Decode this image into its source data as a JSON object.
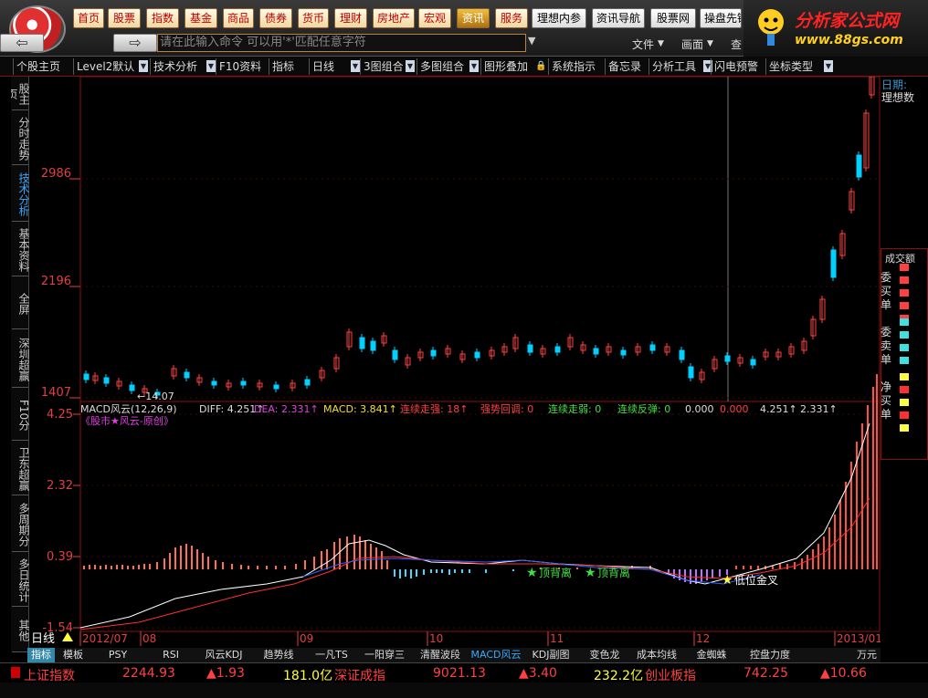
{
  "menu": {
    "items": [
      {
        "label": "首页",
        "active": false
      },
      {
        "label": "股票",
        "active": false
      },
      {
        "label": "指数",
        "active": false
      },
      {
        "label": "基金",
        "active": false
      },
      {
        "label": "商品",
        "active": false
      },
      {
        "label": "债券",
        "active": false
      },
      {
        "label": "货币",
        "active": false
      },
      {
        "label": "理财",
        "active": false
      },
      {
        "label": "房地产",
        "active": false
      },
      {
        "label": "宏观",
        "active": false
      },
      {
        "label": "资讯",
        "active": true
      },
      {
        "label": "服务",
        "active": false
      }
    ],
    "extra": [
      "理想内参",
      "资讯导航",
      "股票网",
      "操盘先锋"
    ],
    "command_placeholder": "请在此输入命令   可以用'*'匹配任意字符",
    "right_menu": [
      "文件",
      "画面",
      "查"
    ]
  },
  "brand": {
    "title": "分析家公式网",
    "url": "www.88gs.com"
  },
  "toolbar": {
    "items": [
      "个股主页",
      "Level2默认",
      "技术分析",
      "F10资料",
      "指标",
      "日线",
      "3图组合",
      "多图组合",
      "图形叠加",
      "系统指示",
      "备忘录",
      "分析工具",
      "闪电预警",
      "坐标类型"
    ]
  },
  "left_tabs": [
    {
      "label": "股主页",
      "active": false
    },
    {
      "label": "分时走势",
      "active": false
    },
    {
      "label": "技术分析",
      "active": true
    },
    {
      "label": "基本资料",
      "active": false
    },
    {
      "label": "全屏",
      "active": false
    },
    {
      "label": "深圳超赢",
      "active": false
    },
    {
      "label": "F10分",
      "active": false
    },
    {
      "label": "卫东超赢",
      "active": false
    },
    {
      "label": "多周期分",
      "active": false
    },
    {
      "label": "多日统计",
      "active": false
    },
    {
      "label": "其他",
      "active": false
    }
  ],
  "price_axis": {
    "labels": [
      "2986",
      "2196",
      "1407"
    ],
    "low_marker": "←14.07"
  },
  "macd": {
    "header_name": "MACD风云(12,26,9)",
    "diff": "DIFF: 4.251↑",
    "dea": "DEA: 2.331↑",
    "macd": "MACD: 3.841↑",
    "s1": "连续走强: 18↑",
    "s2": "强势回调: 0",
    "s3": "连续走弱: 0",
    "s4": "连续反弹: 0",
    "tail": "0.000",
    "tail_red": "0.000",
    "t1": "4.251↑",
    "t2": "2.331↑",
    "subtitle": "《股市★风云-原创》",
    "axis_labels": [
      "4.25",
      "2.32",
      "0.39",
      "-1.54"
    ],
    "annotations": [
      "顶背离",
      "顶背离",
      "低位金叉"
    ]
  },
  "right_panel": {
    "date_label": "日期:",
    "name_label": "理想数",
    "volume_label": "成交额",
    "labels": [
      "委买单",
      "委卖单",
      "净买单"
    ]
  },
  "timeline": {
    "period": "日线",
    "dates": [
      "2012/07",
      "08",
      "09",
      "10",
      "11",
      "12",
      "2013/01"
    ]
  },
  "bottom_tabs": {
    "items": [
      "指标",
      "模板",
      "PSY",
      "RSI",
      "风云KDJ",
      "趋势线",
      "一凡TS",
      "一阳穿三",
      "清醒波段",
      "MACD风云",
      "KDJ副图",
      "变色龙",
      "成本均线",
      "金蜘蛛",
      "控盘力度"
    ],
    "active": "MACD风云",
    "unit": "万元"
  },
  "status": {
    "sh_name": "上证指数",
    "sh_value": "2244.93",
    "sh_change": "▲1.93",
    "sh_amount": "181.0亿",
    "sz_name": "深证成指",
    "sz_value": "9021.13",
    "sz_change": "▲3.40",
    "sz_amount": "232.2亿",
    "cy_name": "创业板指",
    "cy_value": "742.25",
    "cy_change": "▲10.66"
  },
  "colors": {
    "up": "#ff3333",
    "down": "#00c8ff",
    "accent": "#c00000"
  }
}
